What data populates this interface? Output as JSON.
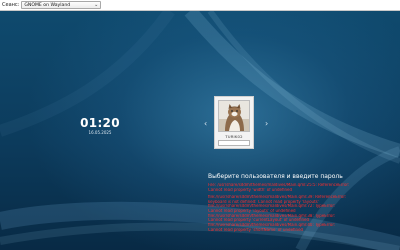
{
  "session": {
    "label": "Сеанс:",
    "selected": "GNOME on Wayland"
  },
  "clock": {
    "time": "01:20",
    "date": "16.05.2025"
  },
  "user": {
    "name": "TURIK02"
  },
  "prompt": "Выберите пользователя и введите пароль",
  "error_lines": [
    "File: /usr/share/sddm/themes/maldives/Main.qml:25:5: ReferenceError:",
    "Cannot read property 'width' of undefined"
  ],
  "warning_lines": [
    "file:///usr/share/sddm/themes/maldives/Main.qml:39: ReferenceError:",
    "keyboard is not defined: Cannot read property 'layouts'",
    "file:///usr/share/sddm/themes/maldives/Main.qml:72: TypeError:",
    "Cannot read property 'layouts' of undefined",
    "file:///usr/share/sddm/themes/maldives/Main.qml:38: TypeError:",
    "Cannot read property 'currentLayout' of undefined",
    "file:///usr/share/sddm/themes/maldives/Main.qml:40: TypeError:",
    "Cannot read property 'shortName' of undefined"
  ],
  "colors": {
    "background": "#0c3b5c",
    "error_text": "#ff2c2c"
  }
}
